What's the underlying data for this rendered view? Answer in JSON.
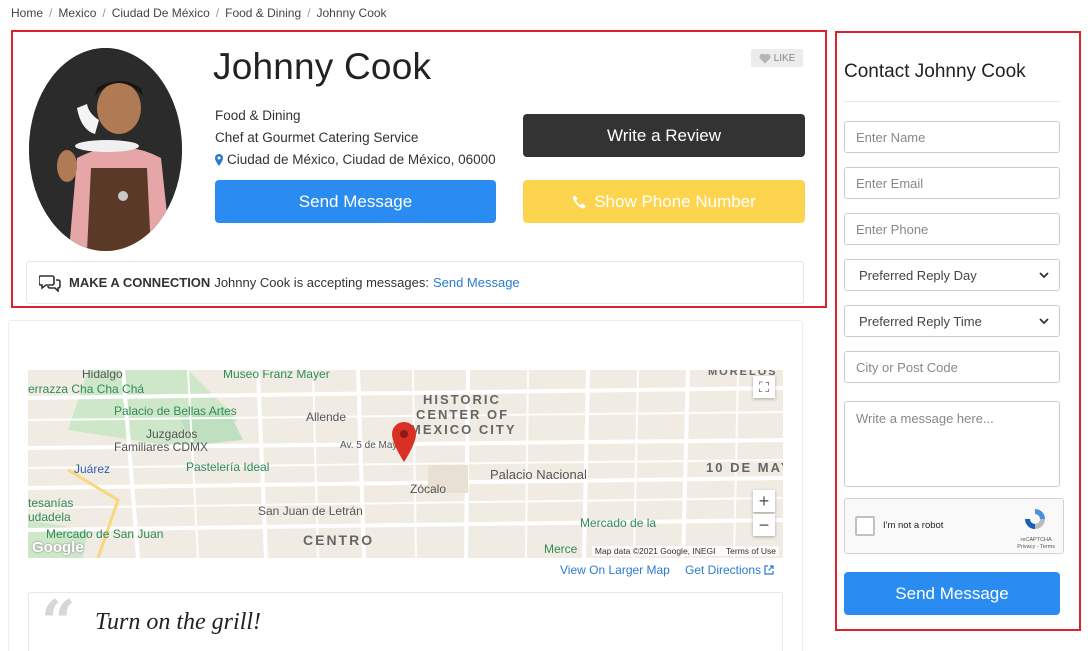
{
  "breadcrumb": [
    "Home",
    "Mexico",
    "Ciudad De México",
    "Food & Dining",
    "Johnny Cook"
  ],
  "profile": {
    "name": "Johnny Cook",
    "like_label": "LIKE",
    "category": "Food & Dining",
    "job": "Chef at Gourmet Catering Service",
    "location": "Ciudad de México, Ciudad de México, 06000",
    "write_review_label": "Write a Review",
    "send_message_label": "Send Message",
    "show_phone_label": "Show Phone Number",
    "connection": {
      "heading": "MAKE A CONNECTION",
      "text": "Johnny Cook is accepting messages:",
      "link": "Send Message"
    }
  },
  "map": {
    "labels": {
      "hidalgo": "Hidalgo",
      "museo": "Museo Franz Mayer",
      "terraza": "errazza Cha Cha Chá",
      "bellas_artes": "Palacio de Bellas Artes",
      "allende": "Allende",
      "historic": "HISTORIC",
      "center_of": "CENTER OF",
      "mexico_city": "MEXICO CITY",
      "juzgados": "Juzgados",
      "familiares": "Familiares CDMX",
      "av5mayo": "Av. 5 de Mayo",
      "juarez": "Juárez",
      "pasteleria": "Pastelería Ideal",
      "palacio_nacional": "Palacio Nacional",
      "diez_mayo": "10 DE MAY",
      "zocalo": "Zócalo",
      "artesanias": "tesanías",
      "ciudadela": "udadela",
      "san_juan": "San Juan de Letrán",
      "mercado_sj": "Mercado de San Juan",
      "centro": "CENTRO",
      "mercado_la": "Mercado de la",
      "merce": "Merce",
      "morelos": "MORELOS"
    },
    "attribution": "Map data ©2021 Google, INEGI",
    "terms": "Terms of Use",
    "zoom_in": "+",
    "zoom_out": "−",
    "view_larger": "View On Larger Map",
    "get_directions": "Get Directions"
  },
  "quote": {
    "mark": "“",
    "text": "Turn on the grill!"
  },
  "contact": {
    "title": "Contact Johnny Cook",
    "name_placeholder": "Enter Name",
    "email_placeholder": "Enter Email",
    "phone_placeholder": "Enter Phone",
    "reply_day": "Preferred Reply Day",
    "reply_time": "Preferred Reply Time",
    "city_placeholder": "City or Post Code",
    "message_placeholder": "Write a message here...",
    "captcha_label": "I'm not a robot",
    "captcha_brand": "reCAPTCHA",
    "captcha_terms": "Privacy - Terms",
    "send_label": "Send Message"
  },
  "colors": {
    "accent_blue": "#2a8cf0",
    "dark_button": "#333333",
    "phone_yellow": "#fdd44e",
    "highlight_red": "#d9232d"
  }
}
